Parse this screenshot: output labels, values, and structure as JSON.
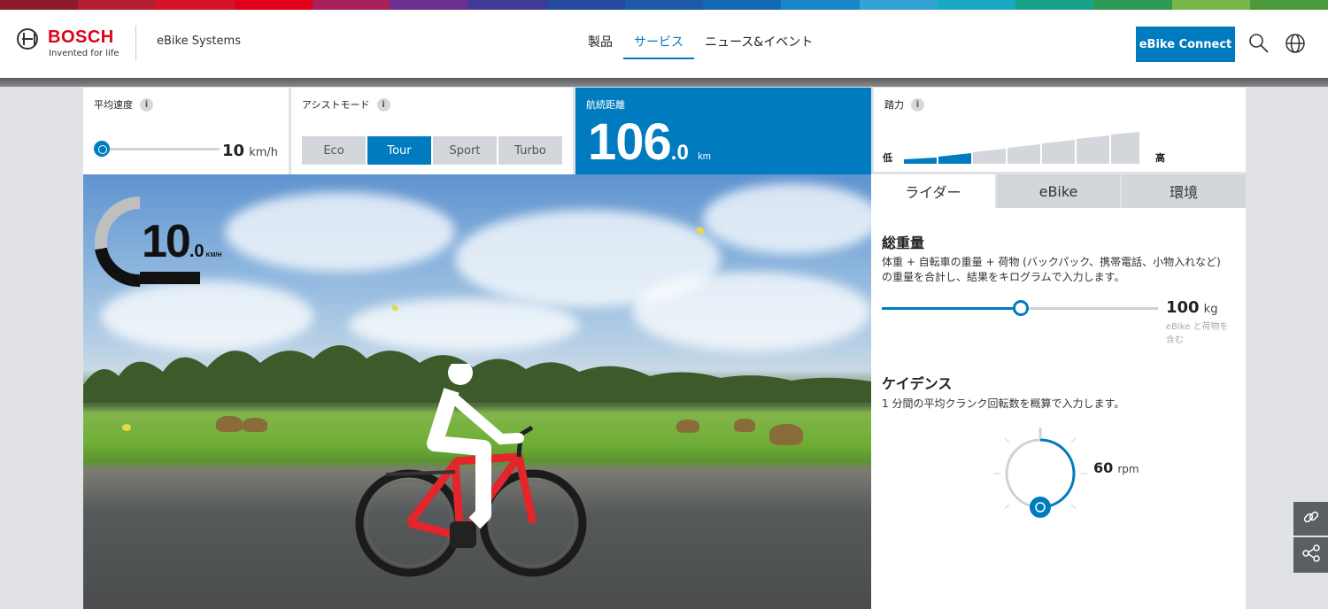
{
  "brand": {
    "name": "BOSCH",
    "tagline": "Invented for life",
    "site": "eBike Systems",
    "colors": {
      "red": "#e0001a",
      "blue": "#007bc0"
    }
  },
  "nav": {
    "items": [
      {
        "label": "製品"
      },
      {
        "label": "サービス",
        "active": true
      },
      {
        "label": "ニュース&イベント"
      }
    ]
  },
  "header_actions": {
    "connect_label": "eBike Connect",
    "search_icon": "search-icon",
    "language_icon": "globe-icon"
  },
  "speed": {
    "label": "平均速度",
    "value": "10",
    "unit": "km/h",
    "slider_fraction": 0.0
  },
  "assist": {
    "label": "アシストモード",
    "modes": [
      "Eco",
      "Tour",
      "Sport",
      "Turbo"
    ],
    "selected": "Tour"
  },
  "range": {
    "label": "航続距離",
    "value_int": "106",
    "value_dec": ".0",
    "unit": "km"
  },
  "pedal_force": {
    "label": "踏力",
    "low": "低",
    "high": "高",
    "level": 2,
    "steps": 7
  },
  "speedometer": {
    "value_int": "10",
    "value_dec": ".0",
    "unit": "KM/H"
  },
  "tabs": [
    {
      "label": "ライダー",
      "active": true
    },
    {
      "label": "eBike"
    },
    {
      "label": "環境"
    }
  ],
  "weight": {
    "title": "総重量",
    "desc_line1": "体重 + 自転車の重量 + 荷物 (バックパック、携帯電話、小物入れなど)",
    "desc_line2": "の重量を合計し、結果をキログラムで入力します。",
    "value": "100",
    "unit": "kg",
    "note_line1": "eBike と荷物を",
    "note_line2": "含む",
    "slider_fraction": 0.5
  },
  "cadence": {
    "title": "ケイデンス",
    "desc": "1 分間の平均クランク回転数を概算で入力します。",
    "value": "60",
    "unit": "rpm"
  },
  "side_buttons": {
    "link_icon": "link-icon",
    "share_icon": "share-icon"
  }
}
